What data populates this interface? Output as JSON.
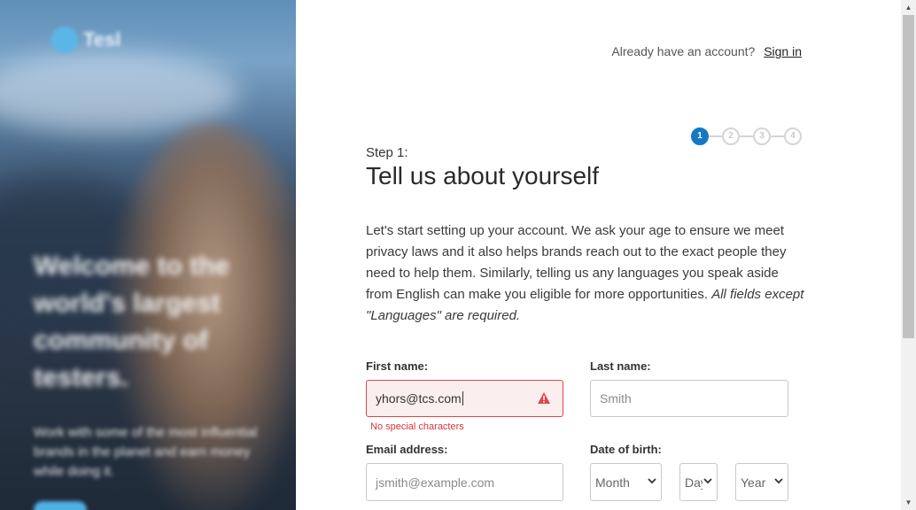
{
  "hero": {
    "logo_text": "Tesl",
    "headline": "Welcome to the world's largest community of testers.",
    "subtext": "Work with some of the most influential brands in the planet and earn money while doing it."
  },
  "header": {
    "account_prompt": "Already have an account?",
    "signin_label": "Sign in"
  },
  "stepper": {
    "steps": [
      "1",
      "2",
      "3",
      "4"
    ],
    "active": 1
  },
  "intro": {
    "step_label": "Step 1:",
    "title": "Tell us about yourself",
    "body": "Let's start setting up your account. We ask your age to ensure we meet privacy laws and it also helps brands reach out to the exact people they need to help them. Similarly, telling us any languages you speak aside from English can make you eligible for more opportunities.",
    "note": "All fields except \"Languages\" are required."
  },
  "form": {
    "first_name": {
      "label": "First name:",
      "value": "yhors@tcs.com",
      "error": "No special characters"
    },
    "last_name": {
      "label": "Last name:",
      "placeholder": "Smith"
    },
    "email": {
      "label": "Email address:",
      "placeholder": "jsmith@example.com"
    },
    "dob": {
      "label": "Date of birth:",
      "month": "Month",
      "day": "Day",
      "year": "Year"
    }
  },
  "colors": {
    "accent": "#1478c4",
    "error": "#e0474c",
    "error_bg": "#fbeeee"
  }
}
